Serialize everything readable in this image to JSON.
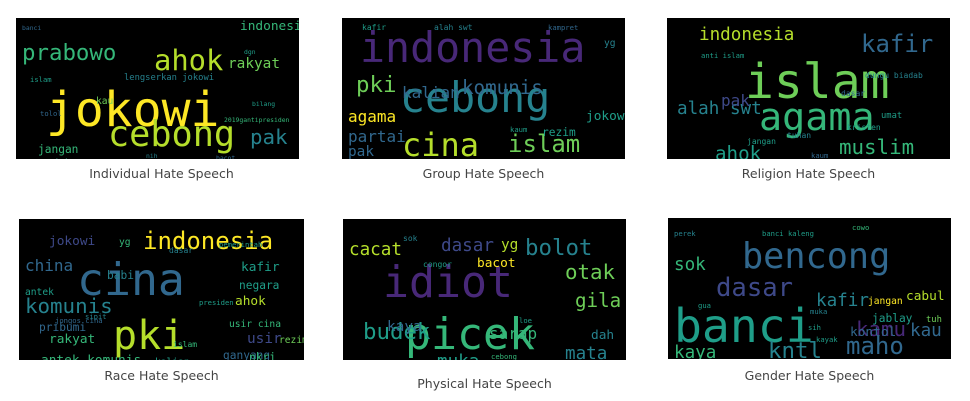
{
  "colors": {
    "background": "#000000",
    "caption_text": "#444444",
    "palette": [
      "#fde725",
      "#b5de2b",
      "#6ece58",
      "#35b779",
      "#1f9e89",
      "#26828e",
      "#31688e",
      "#3e4989",
      "#482878",
      "#440154"
    ]
  },
  "panels": [
    {
      "id": "individual",
      "caption": "Individual Hate Speech",
      "words": [
        {
          "t": "jokowi",
          "s": 3,
          "c": 0
        },
        {
          "t": "cebong",
          "s": 2.2,
          "c": 1
        },
        {
          "t": "ahok",
          "s": 1.8,
          "c": 1
        },
        {
          "t": "prabowo",
          "s": 1.4,
          "c": 3
        },
        {
          "t": "pak",
          "s": 1.3,
          "c": 5
        },
        {
          "t": "rakyat",
          "s": 0.9,
          "c": 2
        },
        {
          "t": "indonesia",
          "s": 0.8,
          "c": 3
        },
        {
          "t": "presiden",
          "s": 0.8,
          "c": 4
        },
        {
          "t": "jangan",
          "s": 0.7,
          "c": 3
        },
        {
          "t": "dasar",
          "s": 0.7,
          "c": 5
        },
        {
          "t": "kau",
          "s": 0.6,
          "c": 2
        },
        {
          "t": "lengserkan jokowi",
          "s": 0.55,
          "c": 5
        },
        {
          "t": "islam",
          "s": 0.45,
          "c": 4
        },
        {
          "t": "anies sandi",
          "s": 0.4,
          "c": 5
        },
        {
          "t": "2019gantipresiden",
          "s": 0.4,
          "c": 3
        },
        {
          "t": "tolol",
          "s": 0.45,
          "c": 6
        },
        {
          "t": "bilang",
          "s": 0.4,
          "c": 4
        },
        {
          "t": "kayak",
          "s": 0.4,
          "c": 7
        },
        {
          "t": "nih",
          "s": 0.4,
          "c": 5
        },
        {
          "t": "banci",
          "s": 0.4,
          "c": 6
        },
        {
          "t": "bacot",
          "s": 0.4,
          "c": 6
        },
        {
          "t": "dgn",
          "s": 0.4,
          "c": 4
        }
      ]
    },
    {
      "id": "group",
      "caption": "Group Hate Speech",
      "words": [
        {
          "t": "indonesia",
          "s": 2.6,
          "c": 8
        },
        {
          "t": "cebong",
          "s": 2.6,
          "c": 5
        },
        {
          "t": "cina",
          "s": 2.0,
          "c": 1
        },
        {
          "t": "islam",
          "s": 1.5,
          "c": 2
        },
        {
          "t": "komunis",
          "s": 1.2,
          "c": 6
        },
        {
          "t": "pki",
          "s": 1.4,
          "c": 2
        },
        {
          "t": "kalian",
          "s": 1.0,
          "c": 6
        },
        {
          "t": "agama",
          "s": 1.0,
          "c": 0
        },
        {
          "t": "partai",
          "s": 1.0,
          "c": 6
        },
        {
          "t": "jokowi",
          "s": 0.8,
          "c": 4
        },
        {
          "t": "pak",
          "s": 0.9,
          "c": 6
        },
        {
          "t": "rezim",
          "s": 0.7,
          "c": 4
        },
        {
          "t": "kafir",
          "s": 0.5,
          "c": 4
        },
        {
          "t": "alah swt",
          "s": 0.5,
          "c": 5
        },
        {
          "t": "yg",
          "s": 0.6,
          "c": 5
        },
        {
          "t": "kampret",
          "s": 0.45,
          "c": 6
        },
        {
          "t": "kaum",
          "s": 0.45,
          "c": 4
        },
        {
          "t": "jangan",
          "s": 0.4,
          "c": 5
        },
        {
          "t": "dasar",
          "s": 0.4,
          "c": 6
        }
      ]
    },
    {
      "id": "religion",
      "caption": "Religion Hate Speech",
      "words": [
        {
          "t": "islam",
          "s": 3,
          "c": 2
        },
        {
          "t": "agama",
          "s": 2.4,
          "c": 3
        },
        {
          "t": "kafir",
          "s": 1.5,
          "c": 6
        },
        {
          "t": "muslim",
          "s": 1.3,
          "c": 3
        },
        {
          "t": "indonesia",
          "s": 1.1,
          "c": 1
        },
        {
          "t": "ahok",
          "s": 1.2,
          "c": 4
        },
        {
          "t": "alah swt",
          "s": 1.1,
          "c": 5
        },
        {
          "t": "pak",
          "s": 1.0,
          "c": 7
        },
        {
          "t": "dungu biadab",
          "s": 0.5,
          "c": 5
        },
        {
          "t": "umat",
          "s": 0.55,
          "c": 4
        },
        {
          "t": "kristen",
          "s": 0.5,
          "c": 4
        },
        {
          "t": "tuhan",
          "s": 0.5,
          "c": 5
        },
        {
          "t": "jangan",
          "s": 0.5,
          "c": 4
        },
        {
          "t": "dasar",
          "s": 0.5,
          "c": 6
        },
        {
          "t": "komunis",
          "s": 0.45,
          "c": 5
        },
        {
          "t": "rezim anti",
          "s": 0.45,
          "c": 4
        },
        {
          "t": "kaum",
          "s": 0.45,
          "c": 6
        },
        {
          "t": "anti islam",
          "s": 0.45,
          "c": 4
        }
      ]
    },
    {
      "id": "race",
      "caption": "Race Hate Speech",
      "words": [
        {
          "t": "cina",
          "s": 2.8,
          "c": 6
        },
        {
          "t": "pki",
          "s": 2.5,
          "c": 1
        },
        {
          "t": "indonesia",
          "s": 1.5,
          "c": 0
        },
        {
          "t": "komunis",
          "s": 1.3,
          "c": 5
        },
        {
          "t": "china",
          "s": 1.0,
          "c": 6
        },
        {
          "t": "kafir",
          "s": 0.8,
          "c": 4
        },
        {
          "t": "jokowi",
          "s": 0.8,
          "c": 7
        },
        {
          "t": "antek komunis",
          "s": 0.8,
          "c": 3
        },
        {
          "t": "rakyat",
          "s": 0.8,
          "c": 3
        },
        {
          "t": "ahok",
          "s": 0.8,
          "c": 1
        },
        {
          "t": "negara",
          "s": 0.7,
          "c": 4
        },
        {
          "t": "usir cina",
          "s": 0.6,
          "c": 3
        },
        {
          "t": "ganyang",
          "s": 0.7,
          "c": 6
        },
        {
          "t": "rezim",
          "s": 0.6,
          "c": 2
        },
        {
          "t": "babi",
          "s": 0.7,
          "c": 5
        },
        {
          "t": "pribumi",
          "s": 0.7,
          "c": 6
        },
        {
          "t": "usir",
          "s": 0.9,
          "c": 7
        },
        {
          "t": "antek",
          "s": 0.6,
          "c": 4
        },
        {
          "t": "kalian",
          "s": 0.6,
          "c": 4
        },
        {
          "t": "nkri",
          "s": 0.7,
          "c": 3
        },
        {
          "t": "dgn",
          "s": 0.6,
          "c": 3
        },
        {
          "t": "yg",
          "s": 0.6,
          "c": 3
        },
        {
          "t": "dasar",
          "s": 0.5,
          "c": 5
        },
        {
          "t": "islam",
          "s": 0.5,
          "c": 3
        },
        {
          "t": "jongos cina",
          "s": 0.45,
          "c": 6
        },
        {
          "t": "sipit",
          "s": 0.45,
          "c": 5
        },
        {
          "t": "pemerintah",
          "s": 0.45,
          "c": 4
        },
        {
          "t": "presiden",
          "s": 0.45,
          "c": 4
        }
      ]
    },
    {
      "id": "physical",
      "caption": "Physical Hate Speech",
      "words": [
        {
          "t": "idiot",
          "s": 2.7,
          "c": 8
        },
        {
          "t": "picek",
          "s": 2.7,
          "c": 3
        },
        {
          "t": "bolot",
          "s": 1.4,
          "c": 5
        },
        {
          "t": "budek",
          "s": 1.4,
          "c": 4
        },
        {
          "t": "otak",
          "s": 1.3,
          "c": 2
        },
        {
          "t": "gila",
          "s": 1.2,
          "c": 2
        },
        {
          "t": "mata",
          "s": 1.1,
          "c": 5
        },
        {
          "t": "muka",
          "s": 1.1,
          "c": 4
        },
        {
          "t": "cacat",
          "s": 1.1,
          "c": 1
        },
        {
          "t": "dasar",
          "s": 1.1,
          "c": 7
        },
        {
          "t": "sarap",
          "s": 1.0,
          "c": 3
        },
        {
          "t": "kaya",
          "s": 0.9,
          "c": 6
        },
        {
          "t": "bacot",
          "s": 0.8,
          "c": 0
        },
        {
          "t": "yg",
          "s": 0.9,
          "c": 1
        },
        {
          "t": "dah",
          "s": 0.8,
          "c": 5
        },
        {
          "t": "congor",
          "s": 0.5,
          "c": 4
        },
        {
          "t": "cebong",
          "s": 0.45,
          "c": 3
        },
        {
          "t": "sinting",
          "s": 0.45,
          "c": 5
        },
        {
          "t": "loe",
          "s": 0.45,
          "c": 4
        },
        {
          "t": "sok",
          "s": 0.5,
          "c": 5
        },
        {
          "t": "kau",
          "s": 0.45,
          "c": 4
        }
      ]
    },
    {
      "id": "gender",
      "caption": "Gender Hate Speech",
      "words": [
        {
          "t": "banci",
          "s": 2.9,
          "c": 4
        },
        {
          "t": "bencong",
          "s": 2.2,
          "c": 6
        },
        {
          "t": "dasar",
          "s": 1.6,
          "c": 7
        },
        {
          "t": "maho",
          "s": 1.5,
          "c": 6
        },
        {
          "t": "kntl",
          "s": 1.4,
          "c": 5
        },
        {
          "t": "kamu",
          "s": 1.3,
          "c": 8
        },
        {
          "t": "kafir",
          "s": 1.1,
          "c": 5
        },
        {
          "t": "kaya",
          "s": 1.1,
          "c": 3
        },
        {
          "t": "sok",
          "s": 1.1,
          "c": 3
        },
        {
          "t": "kau",
          "s": 1.1,
          "c": 6
        },
        {
          "t": "cabul",
          "s": 0.8,
          "c": 1
        },
        {
          "t": "kontol",
          "s": 0.8,
          "c": 6
        },
        {
          "t": "jablay",
          "s": 0.7,
          "c": 4
        },
        {
          "t": "anjing",
          "s": 0.6,
          "c": 4
        },
        {
          "t": "jangan",
          "s": 0.6,
          "c": 0
        },
        {
          "t": "tuh",
          "s": 0.55,
          "c": 2
        },
        {
          "t": "banci kaleng",
          "s": 0.45,
          "c": 4
        },
        {
          "t": "perek",
          "s": 0.45,
          "c": 5
        },
        {
          "t": "cowo",
          "s": 0.45,
          "c": 3
        },
        {
          "t": "kayak",
          "s": 0.45,
          "c": 4
        },
        {
          "t": "muka",
          "s": 0.45,
          "c": 5
        },
        {
          "t": "sih",
          "s": 0.45,
          "c": 4
        },
        {
          "t": "lgbt",
          "s": 0.45,
          "c": 5
        },
        {
          "t": "gua",
          "s": 0.45,
          "c": 4
        }
      ]
    }
  ]
}
